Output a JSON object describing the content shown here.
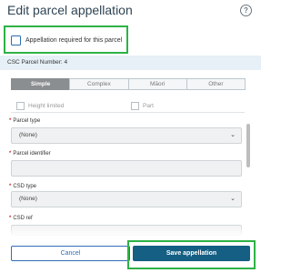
{
  "dialog": {
    "title": "Edit parcel appellation",
    "help_icon": "question-circle-icon"
  },
  "appellation_required": {
    "label": "Appellation required for this parcel",
    "checked": false
  },
  "csc_parcel": {
    "text": "CSC Parcel Number: 4"
  },
  "tabs": [
    {
      "label": "Simple",
      "active": true
    },
    {
      "label": "Complex",
      "active": false
    },
    {
      "label": "Māori",
      "active": false
    },
    {
      "label": "Other",
      "active": false
    }
  ],
  "options": {
    "height_limited": {
      "label": "Height limited",
      "checked": false
    },
    "part": {
      "label": "Part",
      "checked": false
    }
  },
  "fields": {
    "parcel_type": {
      "required_mark": "*",
      "label": "Parcel type",
      "value": "(None)"
    },
    "parcel_identifier": {
      "required_mark": "*",
      "label": "Parcel identifier",
      "value": ""
    },
    "csd_type": {
      "required_mark": "*",
      "label": "CSD type",
      "value": "(None)"
    },
    "csd_ref": {
      "required_mark": "*",
      "label": "CSD ref",
      "value": ""
    }
  },
  "buttons": {
    "cancel": "Cancel",
    "save": "Save appellation"
  },
  "colors": {
    "highlight": "#2db245",
    "primary": "#145f83",
    "link": "#2f6eb5"
  }
}
